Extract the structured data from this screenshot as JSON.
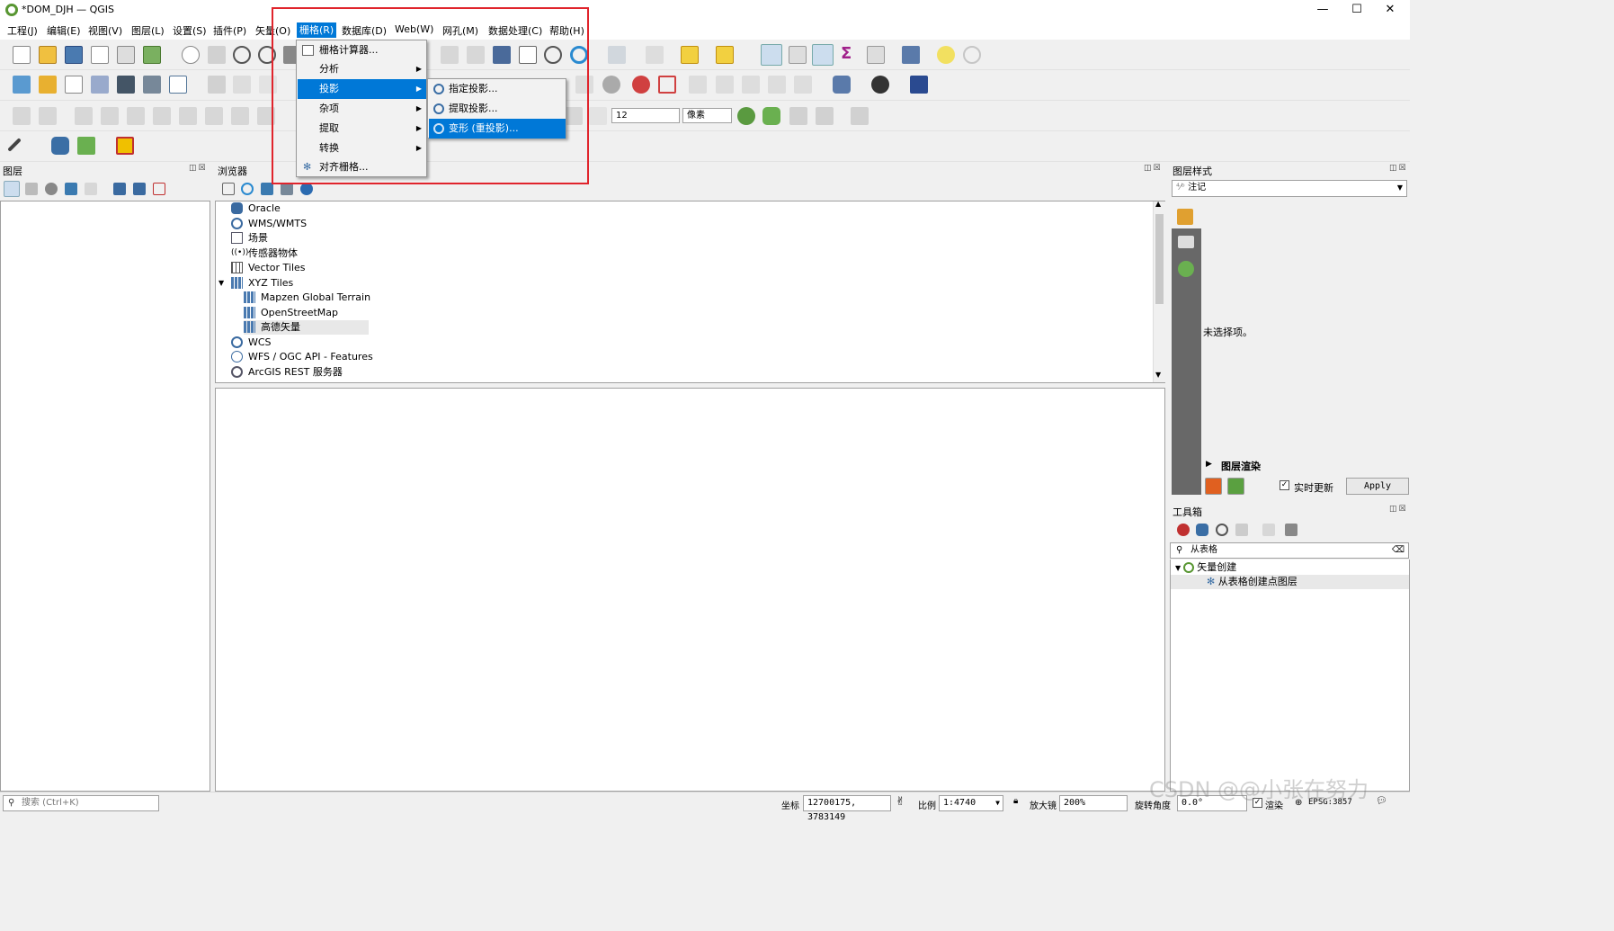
{
  "window": {
    "title": "*DOM_DJH — QGIS",
    "minimize": "—",
    "maximize": "☐",
    "close": "✕"
  },
  "menubar": [
    "工程(J)",
    "编辑(E)",
    "视图(V)",
    "图层(L)",
    "设置(S)",
    "插件(P)",
    "矢量(O)",
    "栅格(R)",
    "数据库(D)",
    "Web(W)",
    "网孔(M)",
    "数据处理(C)",
    "帮助(H)"
  ],
  "raster_menu": {
    "items": [
      "栅格计算器...",
      "分析",
      "投影",
      "杂项",
      "提取",
      "转换",
      "对齐栅格..."
    ],
    "projection_submenu": [
      "指定投影...",
      "提取投影...",
      "变形 (重投影)..."
    ]
  },
  "toolbar": {
    "font_size_value": "12",
    "unit_value": "像素"
  },
  "layers_panel": {
    "title": "图层"
  },
  "browser_panel": {
    "title": "浏览器",
    "items": [
      "Oracle",
      "WMS/WMTS",
      "场景",
      "传感器物体",
      "Vector Tiles",
      "XYZ Tiles",
      "Mapzen Global Terrain",
      "OpenStreetMap",
      "高德矢量",
      "WCS",
      "WFS / OGC API - Features",
      "ArcGIS REST 服务器"
    ]
  },
  "layer_style_panel": {
    "title": "图层样式",
    "selector": "注记",
    "empty_message": "未选择项。",
    "rendering_label": "图层渲染",
    "live_update_label": "实时更新",
    "apply_label": "Apply"
  },
  "toolbox_panel": {
    "title": "工具箱",
    "search_value": "从表格",
    "group": "矢量创建",
    "tool": "从表格创建点图层"
  },
  "statusbar": {
    "search_placeholder": "搜索 (Ctrl+K)",
    "coord_label": "坐标",
    "coord_value": "12700175, 3783149",
    "scale_label": "比例",
    "scale_value": "1:4740",
    "magnifier_label": "放大镜",
    "magnifier_value": "200%",
    "rotation_label": "旋转角度",
    "rotation_value": "0.0°",
    "render_label": "渲染",
    "crs_label": "EPSG:3857"
  },
  "watermark": "CSDN @@小张在努力",
  "colors": {
    "highlight": "#0078d7",
    "redbox": "#e0242c",
    "qgis_green": "#589632"
  }
}
